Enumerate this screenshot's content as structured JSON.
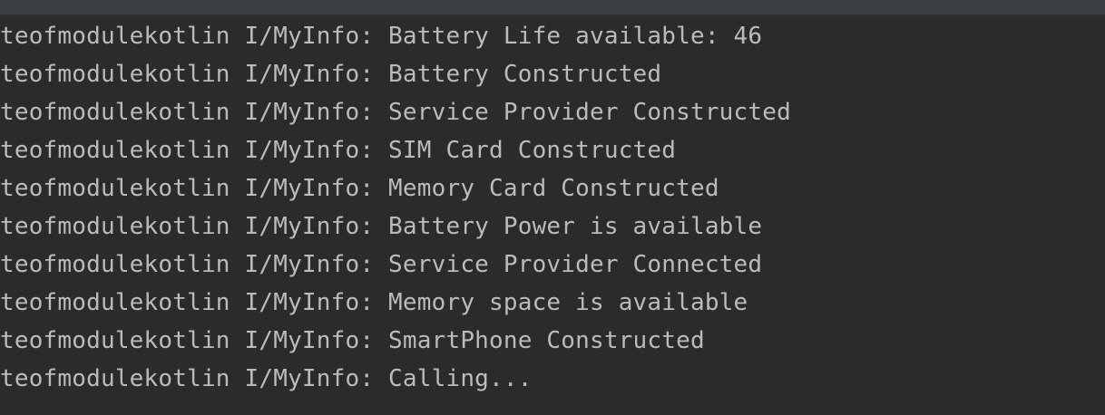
{
  "log": {
    "lines": [
      {
        "tag": "teofmodulekotlin I/MyInfo:",
        "message": "Battery Life available: 46"
      },
      {
        "tag": "teofmodulekotlin I/MyInfo:",
        "message": "Battery Constructed"
      },
      {
        "tag": "teofmodulekotlin I/MyInfo:",
        "message": "Service Provider Constructed"
      },
      {
        "tag": "teofmodulekotlin I/MyInfo:",
        "message": "SIM Card Constructed"
      },
      {
        "tag": "teofmodulekotlin I/MyInfo:",
        "message": "Memory Card Constructed"
      },
      {
        "tag": "teofmodulekotlin I/MyInfo:",
        "message": "Battery Power is available"
      },
      {
        "tag": "teofmodulekotlin I/MyInfo:",
        "message": "Service Provider Connected"
      },
      {
        "tag": "teofmodulekotlin I/MyInfo:",
        "message": "Memory space is available"
      },
      {
        "tag": "teofmodulekotlin I/MyInfo:",
        "message": "SmartPhone Constructed"
      },
      {
        "tag": "teofmodulekotlin I/MyInfo:",
        "message": "Calling..."
      }
    ]
  },
  "colors": {
    "background": "#2b2b2b",
    "text": "#bbbbbb",
    "top_bar": "#3c3f41"
  }
}
